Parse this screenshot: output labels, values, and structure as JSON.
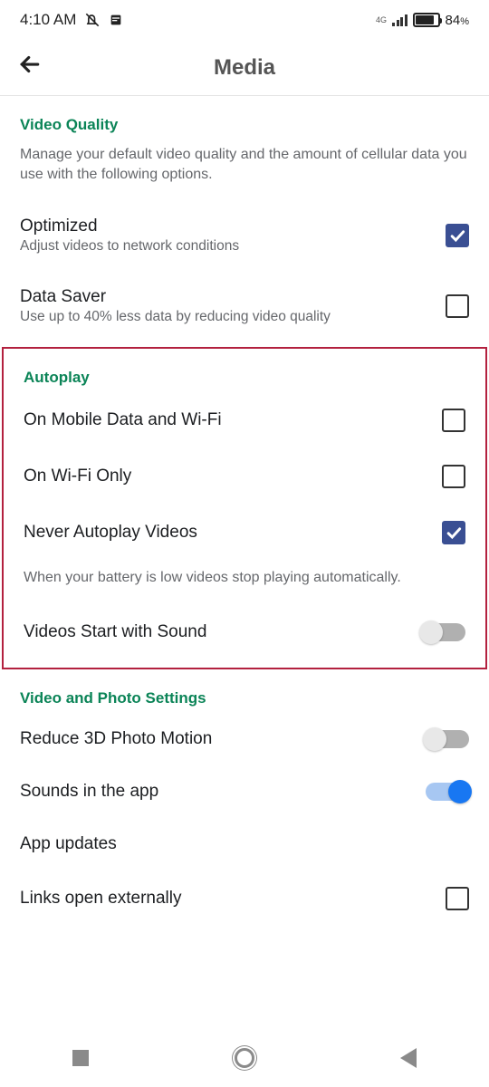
{
  "status": {
    "time": "4:10 AM",
    "net": "4G",
    "battery_pct": "84"
  },
  "header": {
    "title": "Media"
  },
  "video_quality": {
    "heading": "Video Quality",
    "desc": "Manage your default video quality and the amount of cellular data you use with the following options.",
    "optimized": {
      "title": "Optimized",
      "sub": "Adjust videos to network conditions",
      "checked": true
    },
    "data_saver": {
      "title": "Data Saver",
      "sub": "Use up to 40% less data by reducing video quality",
      "checked": false
    }
  },
  "autoplay": {
    "heading": "Autoplay",
    "mobile_wifi": {
      "title": "On Mobile Data and Wi-Fi",
      "checked": false
    },
    "wifi_only": {
      "title": "On Wi-Fi Only",
      "checked": false
    },
    "never": {
      "title": "Never Autoplay Videos",
      "checked": true
    },
    "note": "When your battery is low videos stop playing automatically.",
    "sound": {
      "title": "Videos Start with Sound",
      "on": false
    }
  },
  "vps": {
    "heading": "Video and Photo Settings",
    "reduce3d": {
      "title": "Reduce 3D Photo Motion",
      "on": false
    },
    "sounds": {
      "title": "Sounds in the app",
      "on": true
    },
    "updates": {
      "title": "App updates"
    },
    "links": {
      "title": "Links open externally",
      "checked": false
    }
  }
}
